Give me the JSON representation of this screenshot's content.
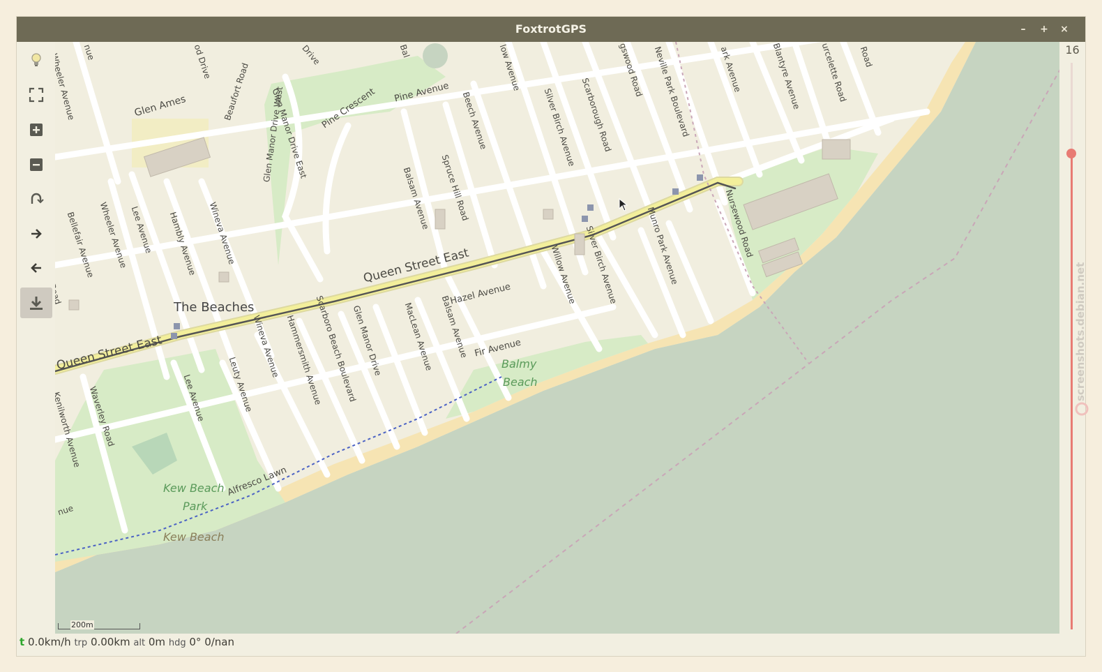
{
  "window": {
    "title": "FoxtrotGPS",
    "controls": {
      "minimize": "–",
      "maximize": "+",
      "close": "×"
    }
  },
  "toolbar": {
    "buttons": [
      {
        "name": "light-bulb-icon"
      },
      {
        "name": "fullscreen-icon"
      },
      {
        "name": "zoom-in-icon"
      },
      {
        "name": "zoom-out-icon"
      },
      {
        "name": "autocenter-icon"
      },
      {
        "name": "forward-arrow-icon"
      },
      {
        "name": "back-arrow-icon"
      },
      {
        "name": "download-icon",
        "active": true
      }
    ]
  },
  "zoom": {
    "level": "16",
    "fraction": 0.84
  },
  "map": {
    "scale_label": "200m",
    "colors": {
      "land": "#f1eedf",
      "water": "#c6d4c1",
      "beach": "#f6e4b3",
      "park": "#d7ebc6",
      "road": "#ffffff",
      "main_road": "#f3ef9b",
      "track": "#555555"
    },
    "labels": {
      "place": "The Beaches",
      "queen1": "Queen Street East",
      "queen2": "Queen Street East",
      "glen_ames": "Glen Ames",
      "pine_crescent": "Pine Crescent",
      "pine_avenue": "Pine Avenue",
      "hazel_avenue": "Hazel Avenue",
      "fir_avenue": "Fir Avenue",
      "balmy_beach_1": "Balmy",
      "balmy_beach_2": "Beach",
      "kew_beach_park_1": "Kew Beach",
      "kew_beach_park_2": "Park",
      "kew_beach": "Kew Beach",
      "alfresco_lawn": "Alfresco Lawn",
      "wheeler_avenue": "Wheeler Avenue",
      "wheeler_avenue_2": "Wheeler Avenue",
      "bellefair_avenue": "Bellefair Avenue",
      "lee_avenue": "Lee Avenue",
      "lee_avenue_2": "Lee Avenue",
      "hambly_avenue": "Hambly Avenue",
      "wineva_avenue": "Wineva Avenue",
      "wineva_avenue_2": "Wineva Avenue",
      "leuty_avenue": "Leuty Avenue",
      "waverley_road": "Waverley Road",
      "kenilworth_avenue": "Kenilworth Avenue",
      "hammersmith_avenue": "Hammersmith Avenue",
      "scarboro_beach_boulevard": "Scarboro Beach Boulevard",
      "glen_manor_drive": "Glen Manor Drive",
      "glen_manor_drive_west": "Glen Manor Drive West",
      "glen_manor_drive_east": "Glen Manor Drive East",
      "beaufort_road": "Beaufort Road",
      "maclean_avenue": "MacLean Avenue",
      "balsam_avenue": "Balsam Avenue",
      "balsam_avenue_2": "Balsam Avenue",
      "spruce_hill_road": "Spruce Hill Road",
      "beech_avenue": "Beech Avenue",
      "willow_avenue": "Willow Avenue",
      "silver_birch_avenue": "Silver Birch Avenue",
      "silver_birch_avenue_2": "Silver Birch Avenue",
      "scarborough_road": "Scarborough Road",
      "kingswood_road": "gswood Road",
      "neville_park_boulevard": "Neville Park Boulevard",
      "munro_park_avenue": "Munro Park Avenue",
      "nursewood_road": "Nursewood Road",
      "park_avenue": "ark Avenue",
      "blantyre_avenue": "Blantyre Avenue",
      "courcelette_road": "urcelette Road",
      "road_top_right": "Road",
      "road_left": "Road",
      "avenue_left": "nue",
      "avenue_top": "nue",
      "drive_top": "Drive",
      "od_drive": "od Drive",
      "low_avenue": "low Avenue",
      "bal_top": "Bal"
    }
  },
  "status": {
    "speed_prefix": "t",
    "speed": "0.0km/h",
    "trip_label": "trp",
    "trip": "0.00km",
    "alt_label": "alt",
    "alt": "0m",
    "hdg_label": "hdg",
    "hdg": "0°",
    "sats": "0/nan"
  },
  "watermark": {
    "text": "screenshots.debian.net"
  }
}
